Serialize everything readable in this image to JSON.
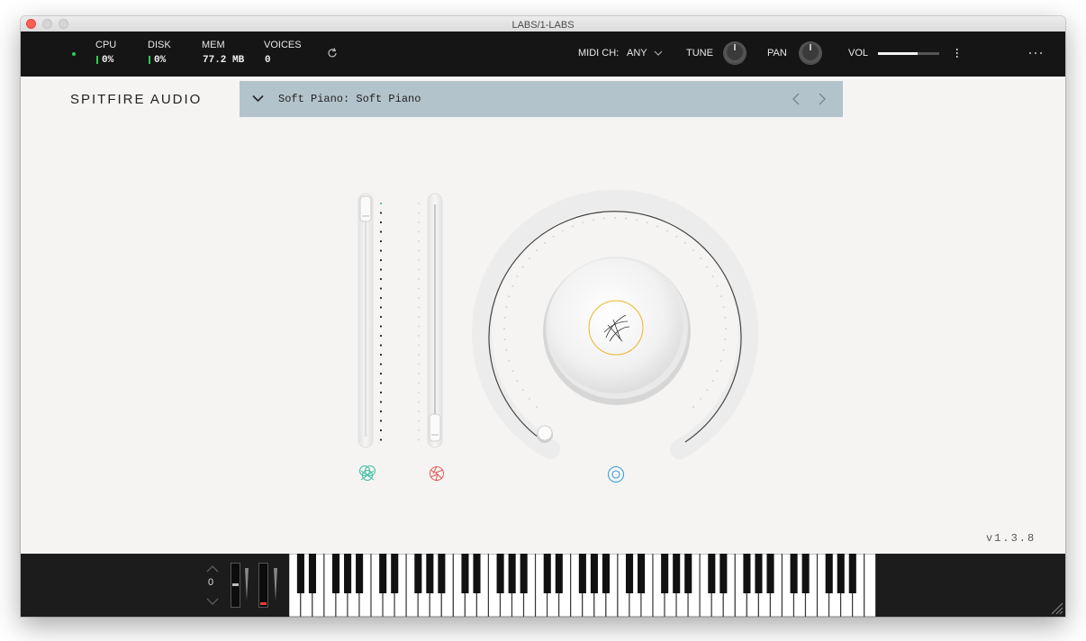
{
  "window": {
    "title": "LABS/1-LABS"
  },
  "status": {
    "cpu_label": "CPU",
    "cpu_value": "0%",
    "disk_label": "DISK",
    "disk_value": "0%",
    "mem_label": "MEM",
    "mem_value": "77.2 MB",
    "voices_label": "VOICES",
    "voices_value": "0",
    "indicator_color": "#2ecc52"
  },
  "controls": {
    "midi_label": "MIDI CH:",
    "midi_value": "ANY",
    "tune_label": "TUNE",
    "pan_label": "PAN",
    "vol_label": "VOL",
    "vol_level": 0.65
  },
  "brand": "SPITFIRE AUDIO",
  "preset": {
    "name": "Soft Piano: Soft Piano",
    "bg_color": "#b3c3cb"
  },
  "version": "v1.3.8",
  "keyboard": {
    "octave": "0",
    "white_keys": 50
  },
  "icons": [
    "reload-icon",
    "chevron-down-icon",
    "chevron-left-icon",
    "chevron-right-icon",
    "more-icon",
    "dynamics-icon",
    "expression-icon",
    "reverb-icon",
    "resize-handle-icon"
  ],
  "accent_colors": {
    "dynamics": "#3fbfa3",
    "expression": "#e25858",
    "reverb": "#3a9ed6",
    "logo_ring": "#f0b429"
  }
}
